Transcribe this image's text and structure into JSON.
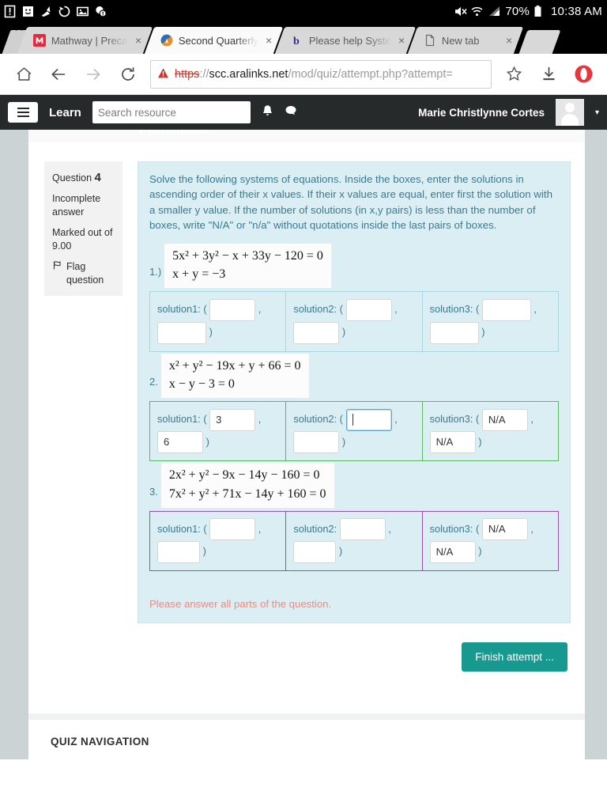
{
  "status_bar": {
    "icons": [
      "alert-icon",
      "smiley-icon",
      "broom-icon",
      "sync-icon",
      "image-icon",
      "info-badge-icon"
    ],
    "mute_icon": "mute-icon",
    "wifi_icon": "wifi-icon",
    "signal_icon": "signal-icon",
    "battery_pct": "70%",
    "battery_icon": "battery-icon",
    "time": "10:38 AM"
  },
  "browser": {
    "tabs": [
      {
        "title": "Mathway | Preca",
        "favicon": "mathway-icon",
        "active": false,
        "close": "×"
      },
      {
        "title": "Second Quarterly",
        "favicon": "aralinks-icon",
        "active": true,
        "close": "×"
      },
      {
        "title": "Please help Syste",
        "favicon": "brainly-icon",
        "active": false,
        "close": "×"
      },
      {
        "title": "New tab",
        "favicon": "page-icon",
        "active": false,
        "close": "×"
      }
    ],
    "toolbar": {
      "home_icon": "home-icon",
      "back_icon": "back-arrow-icon",
      "forward_icon": "forward-arrow-icon",
      "reload_icon": "reload-icon",
      "bookmark_icon": "star-icon",
      "download_icon": "download-icon",
      "menu_icon": "opera-menu-icon"
    },
    "url": {
      "warning_icon": "not-secure-warning-icon",
      "scheme": "https",
      "separator": "://",
      "host": "scc.aralinks.net",
      "path": "/mod/quiz/attempt.php?attempt="
    }
  },
  "moodle_nav": {
    "menu_icon": "hamburger-menu-icon",
    "brand": "Learn",
    "search_placeholder": "Search resource",
    "bell_icon": "notifications-bell-icon",
    "message_icon": "messages-bubble-icon",
    "user_name": "Marie Christlynne Cortes",
    "avatar": "user-avatar",
    "caret": "▾"
  },
  "page": {
    "ghost_heading": "Participate"
  },
  "question_info": {
    "label": "Question",
    "number": "4",
    "state": "Incomplete answer",
    "marked": "Marked out of 9.00",
    "flag_icon": "flag-icon",
    "flag_label": "Flag question"
  },
  "question": {
    "prompt": "Solve the following systems of equations. Inside the boxes, enter the solutions in ascending order of their x values. If their x values are equal, enter first the solution with a smaller y value. If the number of solutions (in x,y pairs) is less than the number of boxes, write \"N/A\" or \"n/a\" without quotations inside the last pairs of boxes.",
    "error": "Please answer all parts of the question.",
    "parts": [
      {
        "num": "1.)",
        "eq1": "5x² + 3y² − x + 33y − 120 = 0",
        "eq2": "x + y = −3",
        "border": "default",
        "solutions": [
          {
            "label": "solution1: (",
            "x": "",
            "y": "",
            "comma": ",",
            "close": ")"
          },
          {
            "label": "solution2: (",
            "x": "",
            "y": "",
            "comma": ",",
            "close": ")"
          },
          {
            "label": "solution3: (",
            "x": "",
            "y": "",
            "comma": ",",
            "close": ")"
          }
        ]
      },
      {
        "num": "2.",
        "eq1": "x² + y² − 19x + y + 66 = 0",
        "eq2": "x − y − 3 = 0",
        "border": "ok",
        "solutions": [
          {
            "label": "solution1: (",
            "x": "3",
            "y": "6",
            "comma": ",",
            "close": ")"
          },
          {
            "label": "solution2: (",
            "x": "",
            "y": "",
            "comma": ",",
            "close": ")",
            "focused": true
          },
          {
            "label": "solution3: (",
            "x": "N/A",
            "y": "N/A",
            "comma": ",",
            "close": ")"
          }
        ]
      },
      {
        "num": "3.",
        "eq1": "2x² + y² − 9x − 14y − 160 = 0",
        "eq2": "7x² + y² + 71x − 14y + 160 = 0",
        "border": "purple",
        "solutions": [
          {
            "label": "solution1: (",
            "x": "",
            "y": "",
            "comma": ",",
            "close": ")"
          },
          {
            "label": "solution2:",
            "x": "",
            "y": "",
            "comma": ",",
            "close": ")"
          },
          {
            "label": "solution3: (",
            "x": "N/A",
            "y": "N/A",
            "comma": ",",
            "close": ")"
          }
        ]
      }
    ]
  },
  "footer": {
    "finish_label": "Finish attempt ...",
    "quiz_nav_title": "QUIZ NAVIGATION"
  },
  "colors": {
    "accent_teal": "#18998f",
    "question_bg": "#dbeef3",
    "question_text": "#3c7a91",
    "error": "#f8867a",
    "ok_border": "#5cb85c",
    "purple_border": "#9b4fb0",
    "navbar": "#262a2b"
  }
}
